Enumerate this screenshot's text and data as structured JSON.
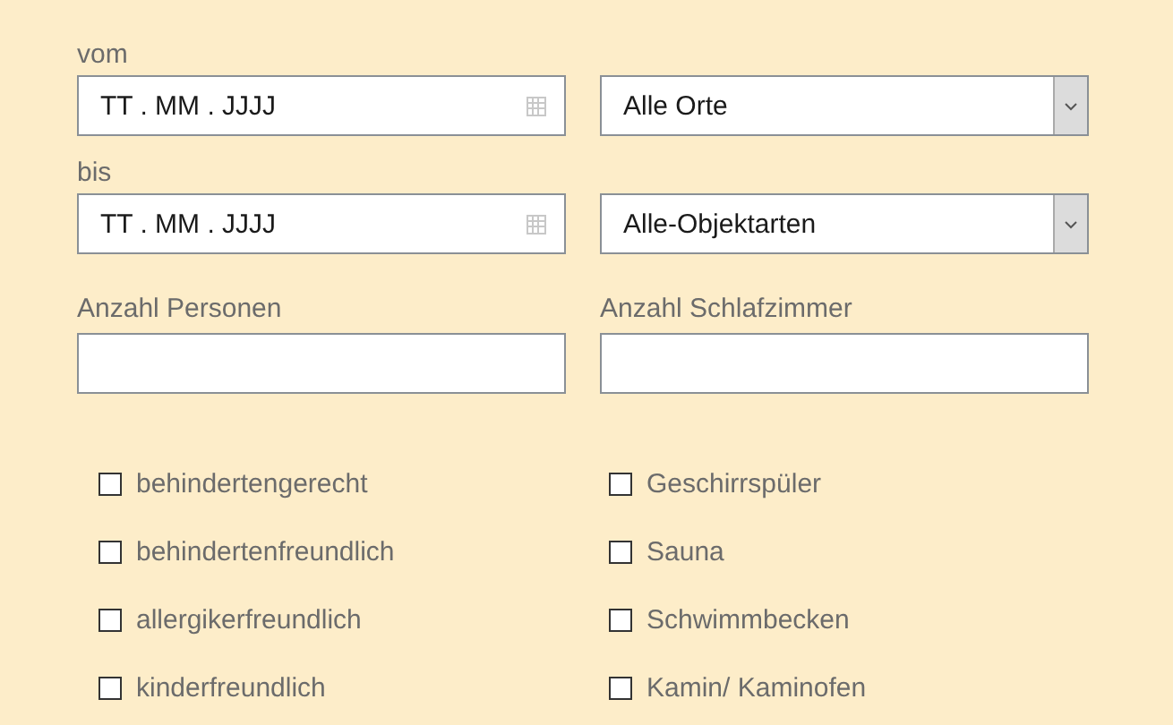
{
  "rows": [
    {
      "left": {
        "label": "vom",
        "kind": "date",
        "value": "TT . MM . JJJJ"
      },
      "right": {
        "kind": "select",
        "value": "Alle Orte"
      }
    },
    {
      "left": {
        "label": "bis",
        "kind": "date",
        "value": "TT . MM . JJJJ"
      },
      "right": {
        "kind": "select",
        "value": "Alle-Objektarten"
      }
    },
    {
      "left": {
        "label": "Anzahl Personen",
        "kind": "text"
      },
      "right": {
        "label": "Anzahl Schlafzimmer",
        "kind": "text"
      }
    }
  ],
  "features": [
    {
      "label": "behindertengerecht",
      "checked": false
    },
    {
      "label": "Geschirrspüler",
      "checked": false
    },
    {
      "label": "behindertenfreundlich",
      "checked": false
    },
    {
      "label": "Sauna",
      "checked": false
    },
    {
      "label": "allergikerfreundlich",
      "checked": false
    },
    {
      "label": "Schwimmbecken",
      "checked": false
    },
    {
      "label": "kinderfreundlich",
      "checked": false
    },
    {
      "label": "Kamin/ Kaminofen",
      "checked": false
    }
  ]
}
